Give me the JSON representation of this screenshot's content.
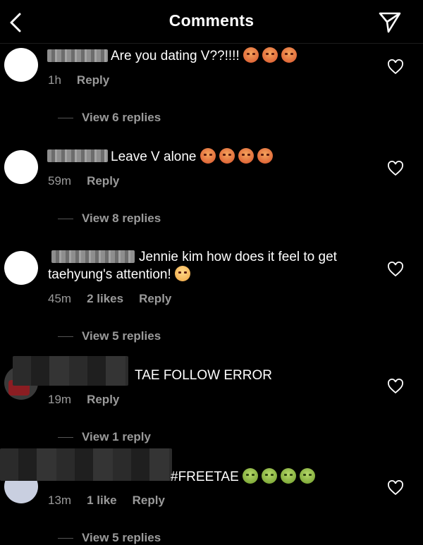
{
  "header": {
    "title": "Comments"
  },
  "comments": [
    {
      "text": "Are you dating V??!!!!",
      "time": "1h",
      "likes": "",
      "reply": "Reply",
      "view_replies": "View 6 replies"
    },
    {
      "text": "Leave V alone",
      "time": "59m",
      "likes": "",
      "reply": "Reply",
      "view_replies": "View 8 replies"
    },
    {
      "text_line1": "Jennie kim how does it feel to get",
      "text_line2": "taehyung's attention!",
      "time": "45m",
      "likes": "2 likes",
      "reply": "Reply",
      "view_replies": "View 5 replies"
    },
    {
      "text": "TAE FOLLOW ERROR",
      "time": "19m",
      "likes": "",
      "reply": "Reply",
      "view_replies": "View 1 reply"
    },
    {
      "text": "#FREETAE",
      "time": "13m",
      "likes": "1 like",
      "reply": "Reply",
      "view_replies": "View 5 replies"
    }
  ],
  "icons": {
    "back": "chevron-left-icon",
    "send": "paper-plane-icon",
    "like": "heart-icon"
  }
}
